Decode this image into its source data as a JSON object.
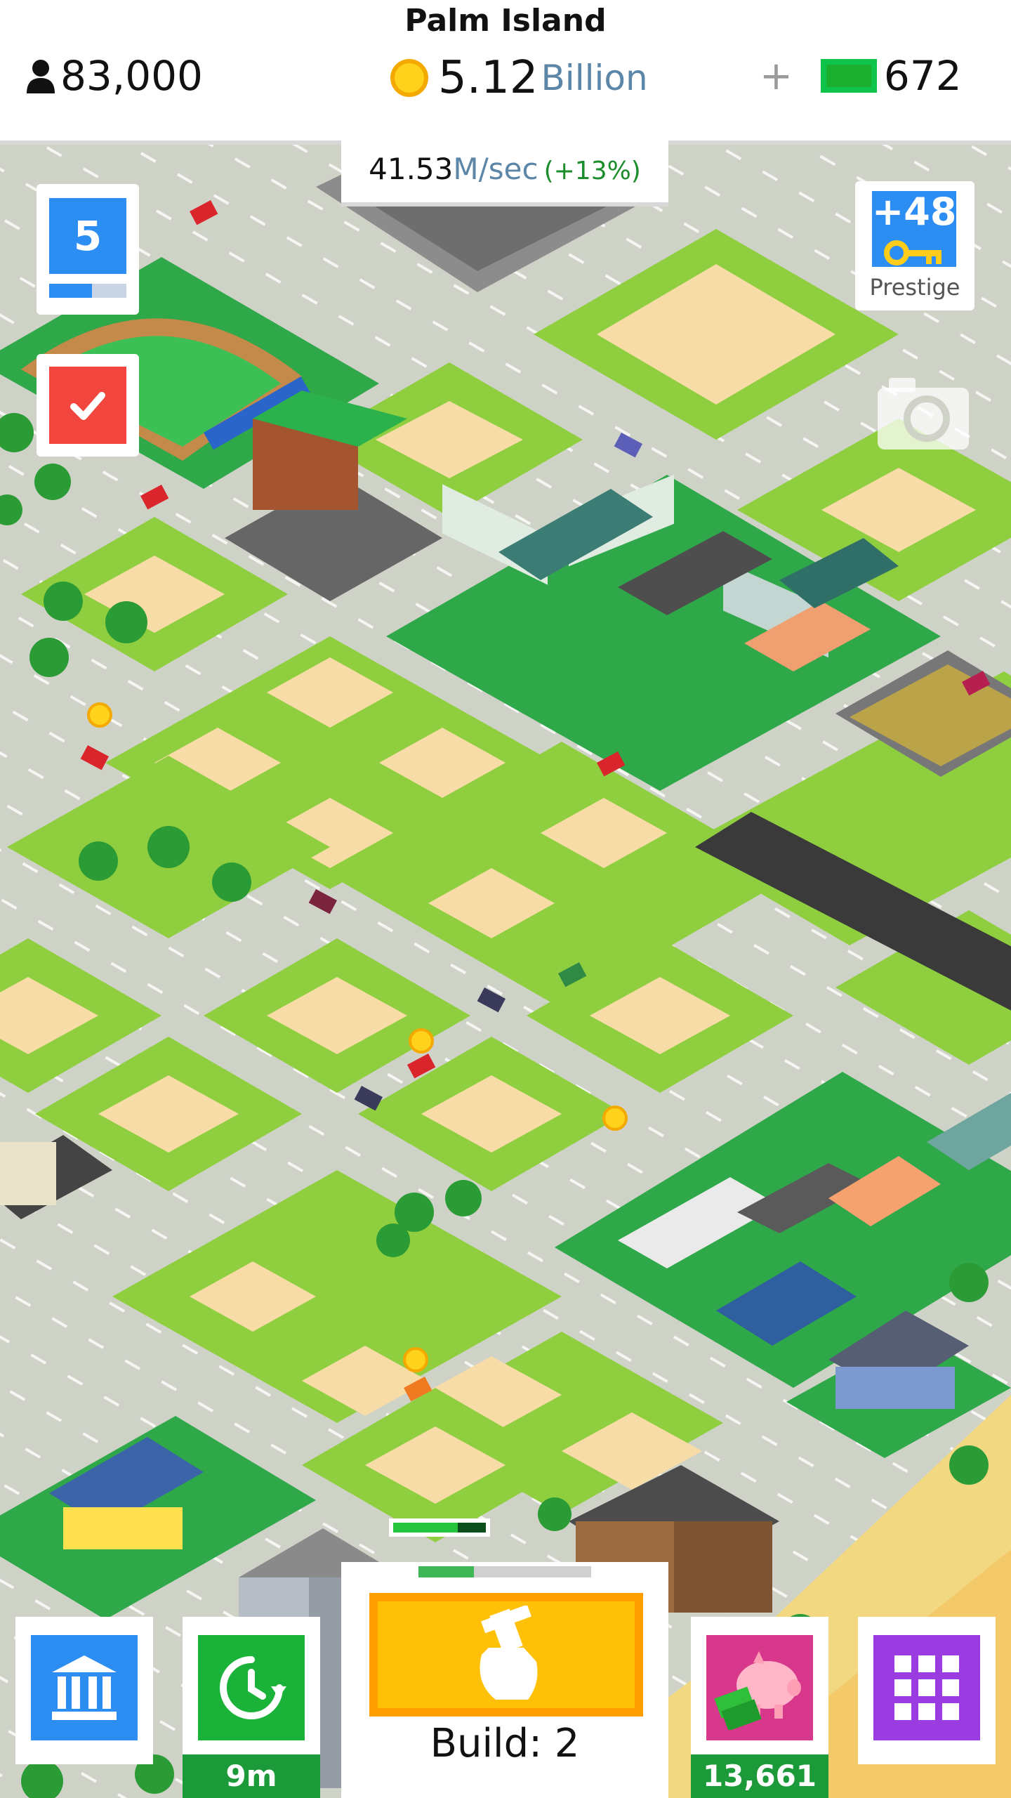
{
  "header": {
    "island_name": "Palm Island",
    "population": "83,000",
    "money_value": "5.12",
    "money_unit": "Billion",
    "plus_label": "+",
    "gems": "672"
  },
  "income": {
    "value": "41.53",
    "unit": "M/sec",
    "bonus": "(+13%)"
  },
  "level": {
    "number": "5",
    "progress_fraction": 0.55
  },
  "prestige": {
    "keys": "+48",
    "label": "Prestige"
  },
  "build_progress_fraction": 0.7,
  "buttons": {
    "build_label": "Build: 2",
    "timer": "9m",
    "piggy_value": "13,661"
  },
  "icons": {
    "population": "person-icon",
    "coin": "coin-icon",
    "cash": "cash-icon",
    "tasks": "checkmark-icon",
    "keys": "key-icon",
    "camera": "camera-icon",
    "bank": "bank-icon",
    "time_warp": "clock-icon",
    "build": "hammer-hand-icon",
    "piggy": "piggy-bank-icon",
    "menu": "grid-icon"
  },
  "colors": {
    "grass": "#8fcf3f",
    "lot": "#f8dca8",
    "road": "#cfd3c7",
    "accent_blue": "#2c8df2",
    "accent_green": "#1bb23a",
    "accent_red": "#f2453d",
    "accent_purple": "#9b3be2",
    "accent_pink": "#d8388c",
    "build_yellow": "#ffc107"
  }
}
